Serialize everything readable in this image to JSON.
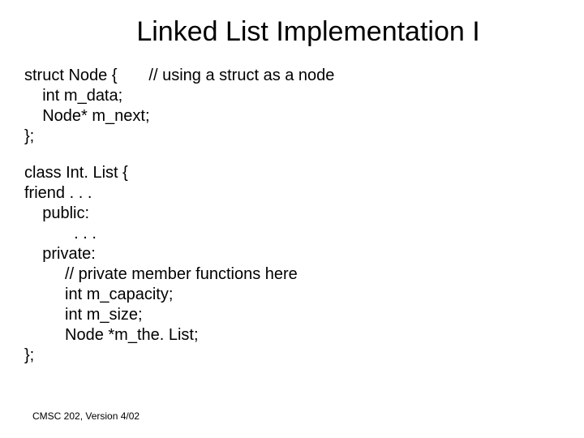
{
  "title": "Linked List Implementation I",
  "code1": "struct Node {       // using a struct as a node\n    int m_data;\n    Node* m_next;\n};",
  "code2": "class Int. List {\nfriend . . .\n    public:\n           . . .\n    private:\n         // private member functions here\n         int m_capacity;\n         int m_size;\n         Node *m_the. List;\n};",
  "footer": "CMSC 202, Version 4/02"
}
